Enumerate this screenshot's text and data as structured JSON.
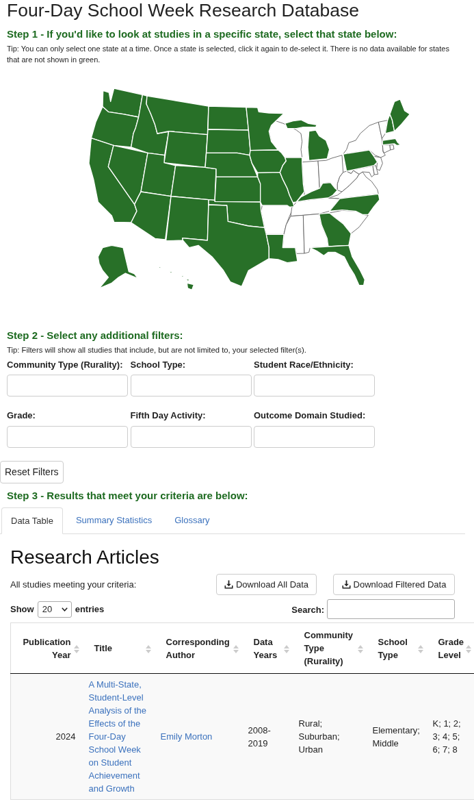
{
  "page_title": "Four-Day School Week Research Database",
  "step1": {
    "heading": "Step 1 - If you'd like to look at studies in a specific state, select that state below:",
    "tip": "Tip: You can only select one state at a time. Once a state is selected, click it again to de-select it. There is no data available for states that are not shown in green."
  },
  "map": {
    "states": [
      {
        "has_data": true
      },
      {
        "has_data": true
      },
      {
        "has_data": true
      },
      {
        "has_data": true
      },
      {
        "has_data": true
      },
      {
        "has_data": true
      },
      {
        "has_data": true
      },
      {
        "has_data": true
      },
      {
        "has_data": true
      },
      {
        "has_data": true
      },
      {
        "has_data": true
      },
      {
        "has_data": true
      },
      {
        "has_data": true
      },
      {
        "has_data": true
      },
      {
        "has_data": true
      },
      {
        "has_data": true
      },
      {
        "has_data": true
      },
      {
        "has_data": true
      },
      {
        "has_data": true
      },
      {
        "has_data": true
      },
      {
        "has_data": false
      },
      {
        "has_data": true
      },
      {
        "has_data": false
      },
      {
        "has_data": true
      },
      {
        "has_data": true
      },
      {
        "has_data": false
      },
      {
        "has_data": true
      },
      {
        "has_data": false
      },
      {
        "has_data": false
      },
      {
        "has_data": false
      },
      {
        "has_data": false
      },
      {
        "has_data": true
      },
      {
        "has_data": true
      },
      {
        "has_data": false
      },
      {
        "has_data": false
      },
      {
        "has_data": true
      },
      {
        "has_data": false
      },
      {
        "has_data": true
      },
      {
        "has_data": false
      },
      {
        "has_data": false
      },
      {
        "has_data": false
      },
      {
        "has_data": false
      },
      {
        "has_data": false
      },
      {
        "has_data": true
      },
      {
        "has_data": true
      },
      {
        "has_data": true
      },
      {
        "has_data": false
      },
      {
        "has_data": false
      },
      {
        "has_data": true
      },
      {
        "has_data": true
      }
    ]
  },
  "step2": {
    "heading": "Step 2 - Select any additional filters:",
    "tip": "Tip: Filters will show all studies that include, but are not limited to, your selected filter(s).",
    "filters": [
      {
        "label": "Community Type (Rurality):"
      },
      {
        "label": "School Type:"
      },
      {
        "label": "Student Race/Ethnicity:"
      },
      {
        "label": "Grade:"
      },
      {
        "label": "Fifth Day Activity:"
      },
      {
        "label": "Outcome Domain Studied:"
      }
    ],
    "reset_button": "Reset Filters"
  },
  "step3": {
    "heading": "Step 3 - Results that meet your criteria are below:",
    "tabs": [
      {
        "label": "Data Table",
        "selected": true
      },
      {
        "label": "Summary Statistics",
        "selected": false
      },
      {
        "label": "Glossary",
        "selected": false
      }
    ]
  },
  "results": {
    "heading": "Research Articles",
    "caption": "All studies meeting your criteria:",
    "download_buttons": [
      "Download All Data",
      "Download Filtered Data"
    ],
    "length_menu": {
      "before": "Show",
      "value": "20",
      "after": "entries"
    },
    "search": {
      "label": "Search:"
    }
  },
  "table": {
    "columns": [
      {
        "label": "Publication Year"
      },
      {
        "label": "Title"
      },
      {
        "label": "Corresponding Author"
      },
      {
        "label": "Data Years"
      },
      {
        "label": "Community Type (Rurality)"
      },
      {
        "label": "School Type"
      },
      {
        "label": "Grade Level"
      }
    ],
    "rows": [
      {
        "cells": [
          {
            "text": "2024",
            "kind": "number"
          },
          {
            "text": "A Multi-State, Student-Level Analysis of the Effects of the Four-Day School Week on Student Achievement and Growth",
            "kind": "link"
          },
          {
            "text": "Emily Morton",
            "kind": "link"
          },
          {
            "text": "2008-2019",
            "kind": "text"
          },
          {
            "text": "Rural; Suburban; Urban",
            "kind": "text"
          },
          {
            "text": "Elementary; Middle",
            "kind": "text"
          },
          {
            "text": "K; 1; 2; 3; 4; 5; 6; 7; 8",
            "kind": "text"
          }
        ]
      }
    ]
  }
}
